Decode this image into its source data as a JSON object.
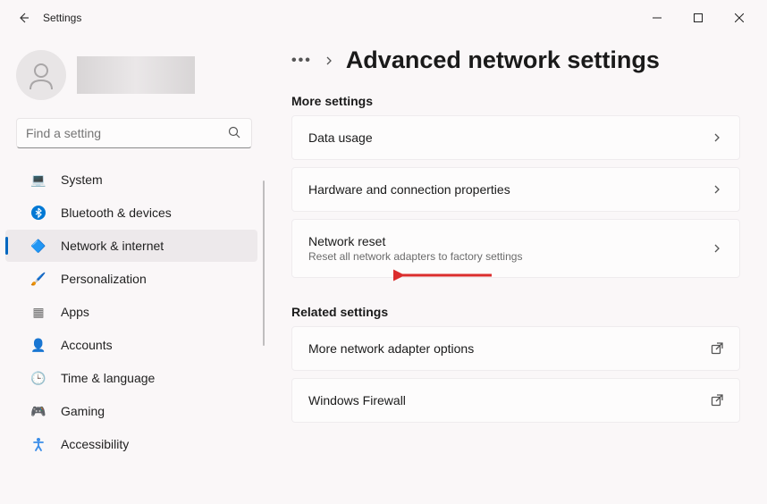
{
  "window": {
    "title": "Settings"
  },
  "search": {
    "placeholder": "Find a setting"
  },
  "sidebar": {
    "items": [
      {
        "label": "System",
        "icon": "💻",
        "color": "#3b8de8"
      },
      {
        "label": "Bluetooth & devices",
        "icon": "bt",
        "color": "#0078d4"
      },
      {
        "label": "Network & internet",
        "icon": "🔷",
        "color": "#00a2ed"
      },
      {
        "label": "Personalization",
        "icon": "🖌️",
        "color": "#d08b55"
      },
      {
        "label": "Apps",
        "icon": "▦",
        "color": "#6b6b6b"
      },
      {
        "label": "Accounts",
        "icon": "👤",
        "color": "#48b168"
      },
      {
        "label": "Time & language",
        "icon": "🕒",
        "color": "#6b6b6b"
      },
      {
        "label": "Gaming",
        "icon": "🎮",
        "color": "#6b6b6b"
      },
      {
        "label": "Accessibility",
        "icon": "acc",
        "color": "#3b8de8"
      }
    ],
    "activeIndex": 2
  },
  "breadcrumb": {
    "title": "Advanced network settings"
  },
  "sections": [
    {
      "header": "More settings",
      "items": [
        {
          "title": "Data usage",
          "sub": "",
          "action": "chevron"
        },
        {
          "title": "Hardware and connection properties",
          "sub": "",
          "action": "chevron"
        },
        {
          "title": "Network reset",
          "sub": "Reset all network adapters to factory settings",
          "action": "chevron"
        }
      ]
    },
    {
      "header": "Related settings",
      "items": [
        {
          "title": "More network adapter options",
          "sub": "",
          "action": "external"
        },
        {
          "title": "Windows Firewall",
          "sub": "",
          "action": "external"
        }
      ]
    }
  ]
}
